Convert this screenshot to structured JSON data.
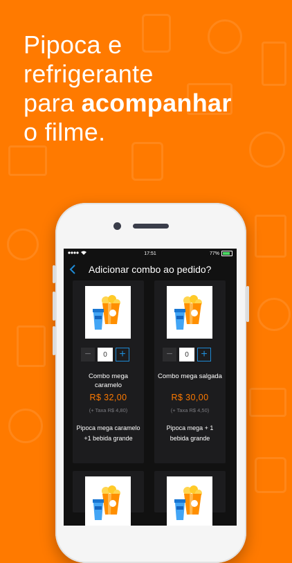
{
  "headline": {
    "line1": "Pipoca e",
    "line2": "refrigerante",
    "line3_prefix": "para ",
    "line3_bold": "acompanhar",
    "line4": "o filme."
  },
  "status_bar": {
    "time": "17:51",
    "battery": "77%"
  },
  "nav": {
    "title": "Adicionar combo ao pedido?"
  },
  "combos": [
    {
      "name": "Combo mega caramelo",
      "price": "R$ 32,00",
      "tax": "(+ Taxa R$ 4,80)",
      "description": "Pipoca mega caramelo +1 bebida grande",
      "quantity": "0"
    },
    {
      "name": "Combo mega salgada",
      "price": "R$ 30,00",
      "tax": "(+ Taxa R$ 4,50)",
      "description": "Pipoca mega + 1 bebida grande",
      "quantity": "0"
    }
  ],
  "stepper": {
    "minus": "−",
    "plus": "+"
  },
  "colors": {
    "background": "#ff7a00",
    "accent": "#ff7a00",
    "button": "#1e8bd6",
    "card": "#1c1c1e"
  },
  "icons": {
    "back": "chevron-left-icon",
    "popcorn": "popcorn-combo-icon",
    "signal": "signal-icon",
    "wifi": "wifi-icon",
    "battery": "battery-icon"
  }
}
